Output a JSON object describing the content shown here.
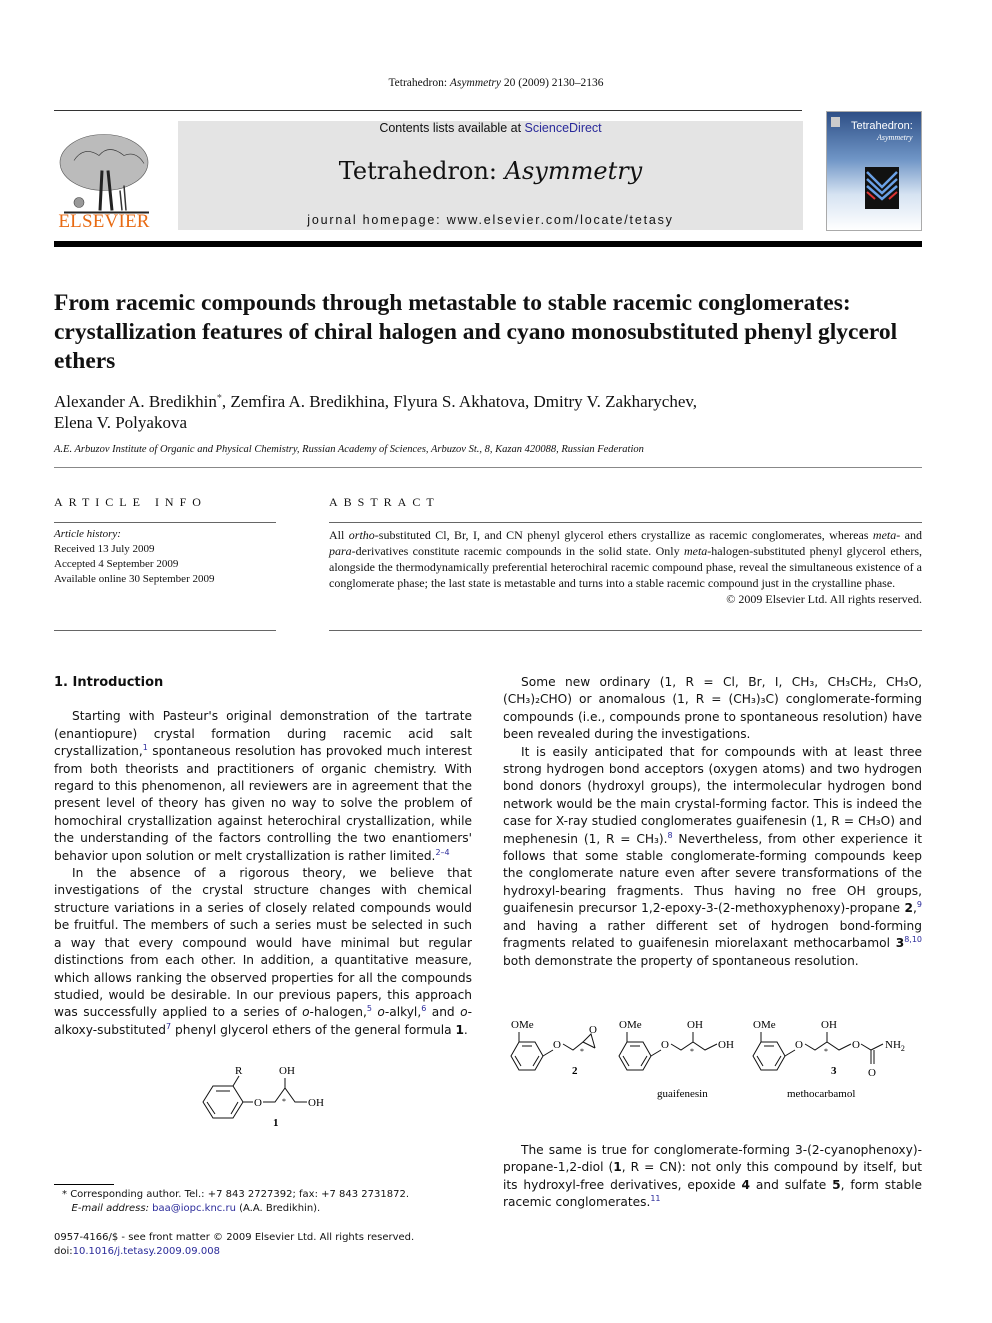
{
  "header": {
    "running_head_journal": "Tetrahedron:",
    "running_head_journal_italic": "Asymmetry",
    "running_head_rest": "20 (2009) 2130–2136",
    "contents_prefix": "Contents lists available at",
    "contents_link": "ScienceDirect",
    "journal_name": "Tetrahedron:",
    "journal_name_italic": "Asymmetry",
    "homepage_prefix": "journal homepage:",
    "homepage_url": "www.elsevier.com/locate/tetasy",
    "publisher": "ELSEVIER",
    "cover_title": "Tetrahedron:",
    "cover_subtitle": "Asymmetry",
    "brand_color": "#e86a12",
    "link_color": "#2a2a9a",
    "banner_color": "#e4e4e4"
  },
  "article": {
    "title": "From racemic compounds through metastable to stable racemic conglomerates: crystallization features of chiral halogen and cyano monosubstituted phenyl glycerol ethers",
    "authors_line1_a": "Alexander A. Bredikhin",
    "authors_mark": "*",
    "authors_line1_b": ", Zemfira A. Bredikhina, Flyura S. Akhatova, Dmitry V. Zakharychev,",
    "authors_line2": "Elena V. Polyakova",
    "affiliation": "A.E. Arbuzov Institute of Organic and Physical Chemistry, Russian Academy of Sciences, Arbuzov St., 8, Kazan 420088, Russian Federation"
  },
  "article_info": {
    "heading": "ARTICLE INFO",
    "history_label": "Article history:",
    "received": "Received 13 July 2009",
    "accepted": "Accepted 4 September 2009",
    "online": "Available online 30 September 2009"
  },
  "abstract": {
    "heading": "ABSTRACT",
    "t1": "All ",
    "i1": "ortho",
    "t2": "-substituted Cl, Br, I, and CN phenyl glycerol ethers crystallize as racemic conglomerates, whereas ",
    "i2": "meta",
    "t3": "- and ",
    "i3": "para",
    "t4": "-derivatives constitute racemic compounds in the solid state. Only ",
    "i4": "meta",
    "t5": "-halogen-substituted phenyl glycerol ethers, alongside the thermodynamically preferential heterochiral racemic compound phase, reveal the simultaneous existence of a conglomerate phase; the last state is metastable and turns into a stable racemic compound just in the crystalline phase.",
    "copyright": "© 2009 Elsevier Ltd. All rights reserved."
  },
  "intro": {
    "heading": "1.  Introduction",
    "p1_a": "Starting with Pasteur's original demonstration of the tartrate (enantiopure) crystal formation during racemic acid salt crystallization,",
    "p1_ref1": "1",
    "p1_b": " spontaneous resolution has provoked much interest from both theorists and practitioners of organic chemistry. With regard to this phenomenon, all reviewers are in agreement that the present level of theory has given no way to solve the problem of homochiral crystallization against heterochiral crystallization, while the understanding of the factors controlling the two enantiomers' behavior upon solution or melt crystallization is rather limited.",
    "p1_ref2": "2–4",
    "p2_a": "In the absence of a rigorous theory, we believe that investigations of the crystal structure changes with chemical structure variations in a series of closely related compounds would be fruitful. The members of such a series must be selected in such a way that every compound would have minimal but regular distinctions from each other. In addition, a quantitative measure, which allows ranking the observed properties for all the compounds studied, would be desirable. In our previous papers, this approach was successfully applied to a series of ",
    "p2_o1": "o",
    "p2_b": "-halogen,",
    "p2_ref5": "5",
    "p2_o2": "o",
    "p2_c": "-alkyl,",
    "p2_ref6": "6",
    "p2_d": " and ",
    "p2_o3": "o",
    "p2_e": "-alkoxy-substituted",
    "p2_ref7": "7",
    "p2_f": " phenyl glycerol ethers of the general formula ",
    "p2_bold": "1",
    "p2_g": ".",
    "p3": "Some new ordinary (1, R = Cl, Br, I, CH₃, CH₃CH₂, CH₃O, (CH₃)₂CHO) or anomalous (1, R = (CH₃)₃C) conglomerate-forming compounds (i.e., compounds prone to spontaneous resolution) have been revealed during the investigations.",
    "p4_a": "It is easily anticipated that for compounds with at least three strong hydrogen bond acceptors (oxygen atoms) and two hydrogen bond donors (hydroxyl groups), the intermolecular hydrogen bond network would be the main crystal-forming factor. This is indeed the case for X-ray studied conglomerates guaifenesin (1, R = CH₃O) and mephenesin (1, R = CH₃).",
    "p4_ref8": "8",
    "p4_b": " Nevertheless, from other experience it follows that some stable conglomerate-forming compounds keep the conglomerate nature even after severe transformations of the hydroxyl-bearing fragments. Thus having no free OH groups, guaifenesin precursor 1,2-epoxy-3-(2-methoxyphenoxy)-propane ",
    "p4_bold2": "2",
    "p4_c": ",",
    "p4_ref9": "9",
    "p4_d": " and having a rather different set of hydrogen bond-forming fragments related to guaifenesin miorelaxant methocarbamol ",
    "p4_bold3": "3",
    "p4_ref810": "8,10",
    "p4_e": " both demonstrate the property of spontaneous resolution.",
    "p5_a": "The same is true for conglomerate-forming 3-(2-cyanophenoxy)-propane-1,2-diol (",
    "p5_b1": "1",
    "p5_b": ", R = CN): not only this compound by itself, but its hydroxyl-free derivatives, epoxide ",
    "p5_b4": "4",
    "p5_c": " and sulfate ",
    "p5_b5": "5",
    "p5_d": ", form stable racemic conglomerates.",
    "p5_ref11": "11"
  },
  "structures": {
    "s1": {
      "substituent": "R",
      "oh_top": "OH",
      "oh_right": "OH",
      "ether_o": "O",
      "stereo": "*",
      "label": "1"
    },
    "s2": {
      "ome": "OMe",
      "ether_o": "O",
      "epoxide_o": "O",
      "stereo": "*",
      "label": "2"
    },
    "s_guai": {
      "ome": "OMe",
      "ether_o": "O",
      "oh_top": "OH",
      "oh_right": "OH",
      "stereo": "*",
      "label": "guaifenesin"
    },
    "s3": {
      "ome": "OMe",
      "ether_o": "O",
      "oh_top": "OH",
      "carb_o": "O",
      "carbonyl_o": "O",
      "nh2": "NH",
      "nh2_sub": "2",
      "stereo": "*",
      "label_num": "3",
      "label": "methocarbamol"
    }
  },
  "footnote": {
    "mark": "*",
    "line1": "Corresponding author. Tel.: +7 843 2727392; fax: +7 843 2731872.",
    "email_label": "E-mail address:",
    "email": "baa@iopc.knc.ru",
    "email_suffix": " (A.A. Bredikhin)."
  },
  "frontmatter": {
    "issn_line": "0957-4166/$ - see front matter © 2009 Elsevier Ltd. All rights reserved.",
    "doi_prefix": "doi:",
    "doi": "10.1016/j.tetasy.2009.09.008"
  }
}
